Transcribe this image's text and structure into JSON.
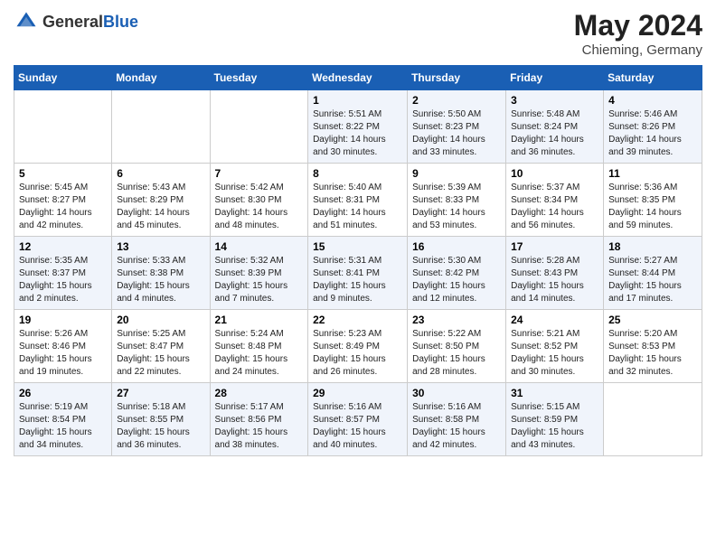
{
  "header": {
    "logo_general": "General",
    "logo_blue": "Blue",
    "month_year": "May 2024",
    "location": "Chieming, Germany"
  },
  "weekdays": [
    "Sunday",
    "Monday",
    "Tuesday",
    "Wednesday",
    "Thursday",
    "Friday",
    "Saturday"
  ],
  "weeks": [
    [
      {
        "day": null
      },
      {
        "day": null
      },
      {
        "day": null
      },
      {
        "day": "1",
        "sunrise": "Sunrise: 5:51 AM",
        "sunset": "Sunset: 8:22 PM",
        "daylight": "Daylight: 14 hours and 30 minutes."
      },
      {
        "day": "2",
        "sunrise": "Sunrise: 5:50 AM",
        "sunset": "Sunset: 8:23 PM",
        "daylight": "Daylight: 14 hours and 33 minutes."
      },
      {
        "day": "3",
        "sunrise": "Sunrise: 5:48 AM",
        "sunset": "Sunset: 8:24 PM",
        "daylight": "Daylight: 14 hours and 36 minutes."
      },
      {
        "day": "4",
        "sunrise": "Sunrise: 5:46 AM",
        "sunset": "Sunset: 8:26 PM",
        "daylight": "Daylight: 14 hours and 39 minutes."
      }
    ],
    [
      {
        "day": "5",
        "sunrise": "Sunrise: 5:45 AM",
        "sunset": "Sunset: 8:27 PM",
        "daylight": "Daylight: 14 hours and 42 minutes."
      },
      {
        "day": "6",
        "sunrise": "Sunrise: 5:43 AM",
        "sunset": "Sunset: 8:29 PM",
        "daylight": "Daylight: 14 hours and 45 minutes."
      },
      {
        "day": "7",
        "sunrise": "Sunrise: 5:42 AM",
        "sunset": "Sunset: 8:30 PM",
        "daylight": "Daylight: 14 hours and 48 minutes."
      },
      {
        "day": "8",
        "sunrise": "Sunrise: 5:40 AM",
        "sunset": "Sunset: 8:31 PM",
        "daylight": "Daylight: 14 hours and 51 minutes."
      },
      {
        "day": "9",
        "sunrise": "Sunrise: 5:39 AM",
        "sunset": "Sunset: 8:33 PM",
        "daylight": "Daylight: 14 hours and 53 minutes."
      },
      {
        "day": "10",
        "sunrise": "Sunrise: 5:37 AM",
        "sunset": "Sunset: 8:34 PM",
        "daylight": "Daylight: 14 hours and 56 minutes."
      },
      {
        "day": "11",
        "sunrise": "Sunrise: 5:36 AM",
        "sunset": "Sunset: 8:35 PM",
        "daylight": "Daylight: 14 hours and 59 minutes."
      }
    ],
    [
      {
        "day": "12",
        "sunrise": "Sunrise: 5:35 AM",
        "sunset": "Sunset: 8:37 PM",
        "daylight": "Daylight: 15 hours and 2 minutes."
      },
      {
        "day": "13",
        "sunrise": "Sunrise: 5:33 AM",
        "sunset": "Sunset: 8:38 PM",
        "daylight": "Daylight: 15 hours and 4 minutes."
      },
      {
        "day": "14",
        "sunrise": "Sunrise: 5:32 AM",
        "sunset": "Sunset: 8:39 PM",
        "daylight": "Daylight: 15 hours and 7 minutes."
      },
      {
        "day": "15",
        "sunrise": "Sunrise: 5:31 AM",
        "sunset": "Sunset: 8:41 PM",
        "daylight": "Daylight: 15 hours and 9 minutes."
      },
      {
        "day": "16",
        "sunrise": "Sunrise: 5:30 AM",
        "sunset": "Sunset: 8:42 PM",
        "daylight": "Daylight: 15 hours and 12 minutes."
      },
      {
        "day": "17",
        "sunrise": "Sunrise: 5:28 AM",
        "sunset": "Sunset: 8:43 PM",
        "daylight": "Daylight: 15 hours and 14 minutes."
      },
      {
        "day": "18",
        "sunrise": "Sunrise: 5:27 AM",
        "sunset": "Sunset: 8:44 PM",
        "daylight": "Daylight: 15 hours and 17 minutes."
      }
    ],
    [
      {
        "day": "19",
        "sunrise": "Sunrise: 5:26 AM",
        "sunset": "Sunset: 8:46 PM",
        "daylight": "Daylight: 15 hours and 19 minutes."
      },
      {
        "day": "20",
        "sunrise": "Sunrise: 5:25 AM",
        "sunset": "Sunset: 8:47 PM",
        "daylight": "Daylight: 15 hours and 22 minutes."
      },
      {
        "day": "21",
        "sunrise": "Sunrise: 5:24 AM",
        "sunset": "Sunset: 8:48 PM",
        "daylight": "Daylight: 15 hours and 24 minutes."
      },
      {
        "day": "22",
        "sunrise": "Sunrise: 5:23 AM",
        "sunset": "Sunset: 8:49 PM",
        "daylight": "Daylight: 15 hours and 26 minutes."
      },
      {
        "day": "23",
        "sunrise": "Sunrise: 5:22 AM",
        "sunset": "Sunset: 8:50 PM",
        "daylight": "Daylight: 15 hours and 28 minutes."
      },
      {
        "day": "24",
        "sunrise": "Sunrise: 5:21 AM",
        "sunset": "Sunset: 8:52 PM",
        "daylight": "Daylight: 15 hours and 30 minutes."
      },
      {
        "day": "25",
        "sunrise": "Sunrise: 5:20 AM",
        "sunset": "Sunset: 8:53 PM",
        "daylight": "Daylight: 15 hours and 32 minutes."
      }
    ],
    [
      {
        "day": "26",
        "sunrise": "Sunrise: 5:19 AM",
        "sunset": "Sunset: 8:54 PM",
        "daylight": "Daylight: 15 hours and 34 minutes."
      },
      {
        "day": "27",
        "sunrise": "Sunrise: 5:18 AM",
        "sunset": "Sunset: 8:55 PM",
        "daylight": "Daylight: 15 hours and 36 minutes."
      },
      {
        "day": "28",
        "sunrise": "Sunrise: 5:17 AM",
        "sunset": "Sunset: 8:56 PM",
        "daylight": "Daylight: 15 hours and 38 minutes."
      },
      {
        "day": "29",
        "sunrise": "Sunrise: 5:16 AM",
        "sunset": "Sunset: 8:57 PM",
        "daylight": "Daylight: 15 hours and 40 minutes."
      },
      {
        "day": "30",
        "sunrise": "Sunrise: 5:16 AM",
        "sunset": "Sunset: 8:58 PM",
        "daylight": "Daylight: 15 hours and 42 minutes."
      },
      {
        "day": "31",
        "sunrise": "Sunrise: 5:15 AM",
        "sunset": "Sunset: 8:59 PM",
        "daylight": "Daylight: 15 hours and 43 minutes."
      },
      {
        "day": null
      }
    ]
  ]
}
